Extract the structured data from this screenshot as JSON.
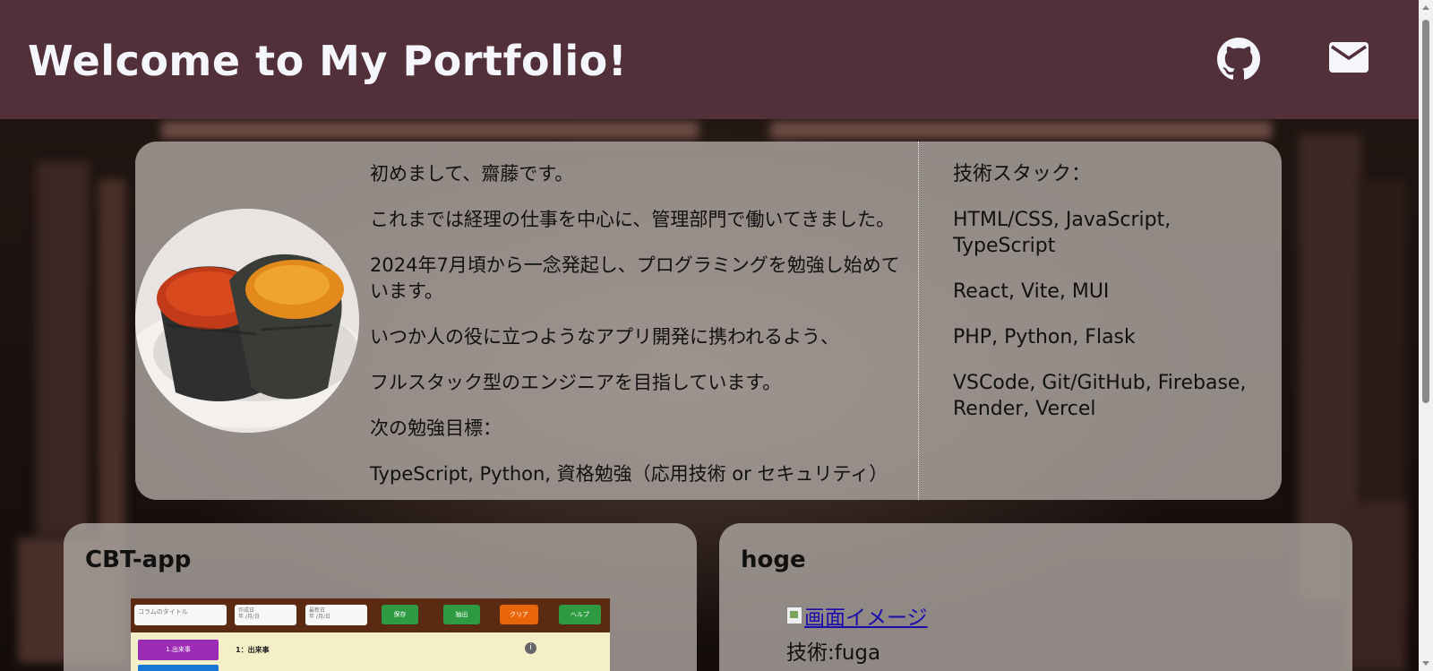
{
  "header": {
    "title": "Welcome to My Portfolio!",
    "icons": [
      "github-icon",
      "mail-icon"
    ],
    "background_color": "#52303a"
  },
  "profile": {
    "avatar_icon": "sushi-photo",
    "about": [
      "初めまして、齋藤です。",
      "これまでは経理の仕事を中心に、管理部門で働いてきました。",
      "2024年7月頃から一念発起し、プログラミングを勉強し始めています。",
      "いつか人の役に立つようなアプリ開発に携われるよう、",
      "フルスタック型のエンジニアを目指しています。",
      "次の勉強目標：",
      "TypeScript, Python, 資格勉強（応用技術 or セキュリティ）"
    ],
    "stack": [
      "技術スタック：",
      "HTML/CSS, JavaScript, TypeScript",
      "React, Vite, MUI",
      "PHP, Python, Flask",
      "VSCode, Git/GitHub, Firebase, Render, Vercel"
    ]
  },
  "projects": [
    {
      "title": "CBT-app",
      "screenshot": {
        "title_placeholder": "コラムのタイトル",
        "created_label": "作成日",
        "updated_label": "最新日",
        "date_placeholder": "年 /月/日",
        "buttons": [
          "保存",
          "抽出",
          "クリア",
          "ヘルプ"
        ],
        "button_colors": [
          "#2e9a41",
          "#2e9a41",
          "#e8650a",
          "#2e9a41"
        ],
        "side_item": "1.出来事",
        "section_heading": "1：出来事"
      }
    },
    {
      "title": "hoge",
      "image_alt": "画面イメージ",
      "tech": "技術:fuga"
    }
  ]
}
